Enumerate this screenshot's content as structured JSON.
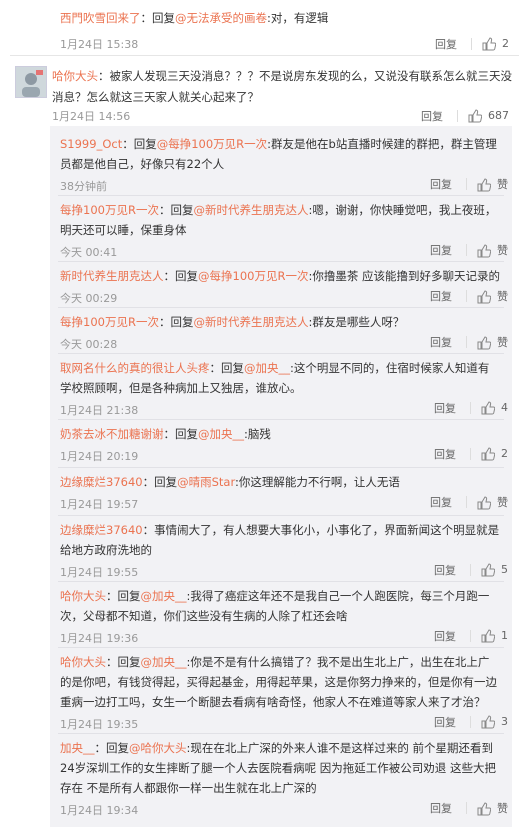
{
  "top_comment": {
    "user": "西門吹雪回来了",
    "reply_word": "：回复",
    "target": "@无法承受的画卷",
    "content": ":对，有逻辑",
    "time": "1月24日 15:38",
    "reply_label": "回复",
    "likes": "2"
  },
  "main_comment": {
    "user": "哈你大头",
    "content": "：被家人发现三天没消息？？？不是说房东发现的么，又说没有联系怎么就三天没消息？怎么就这三天家人就关心起来了？",
    "time": "1月24日 14:56",
    "reply_label": "回复",
    "likes": "687"
  },
  "replies": [
    {
      "user": "S1999_Oct",
      "reply_word": "：回复",
      "target": "@每挣100万见R一次",
      "content": ":群友是他在b站直播时候建的群把，群主管理员都是他自己，好像只有22个人",
      "time": "38分钟前",
      "reply_label": "回复",
      "likes": "赞"
    },
    {
      "user": "每挣100万见R一次",
      "reply_word": "：回复",
      "target": "@新时代养生朋克达人",
      "content": ":嗯，谢谢，你快睡觉吧，我上夜班，明天还可以睡，保重身体",
      "time": "今天 00:41",
      "reply_label": "回复",
      "likes": "赞"
    },
    {
      "user": "新时代养生朋克达人",
      "reply_word": "：回复",
      "target": "@每挣100万见R一次",
      "content": ":你撸墨茶 应该能撸到好多聊天记录的",
      "time": "今天 00:29",
      "reply_label": "回复",
      "likes": "赞"
    },
    {
      "user": "每挣100万见R一次",
      "reply_word": "：回复",
      "target": "@新时代养生朋克达人",
      "content": ":群友是哪些人呀？",
      "time": "今天 00:28",
      "reply_label": "回复",
      "likes": "赞"
    },
    {
      "user": "取网名什么的真的很让人头疼",
      "reply_word": "：回复",
      "target": "@加央__",
      "content": ":这个明显不同的，住宿时候家人知道有学校照顾啊，但是各种病加上又独居，谁放心。",
      "time": "1月24日 21:38",
      "reply_label": "回复",
      "likes": "4"
    },
    {
      "user": "奶茶去冰不加糖谢谢",
      "reply_word": "：回复",
      "target": "@加央__",
      "content": ":脑残",
      "time": "1月24日 20:19",
      "reply_label": "回复",
      "likes": "2"
    },
    {
      "user": "边缘糜烂37640",
      "reply_word": "：回复",
      "target": "@晴雨Star",
      "content": ":你这理解能力不行啊，让人无语",
      "time": "1月24日 19:57",
      "reply_label": "回复",
      "likes": "赞"
    },
    {
      "user": "边缘糜烂37640",
      "reply_word": "",
      "target": "",
      "content": "：事情闹大了，有人想要大事化小，小事化了，界面新闻这个明显就是给地方政府洗地的",
      "time": "1月24日 19:55",
      "reply_label": "回复",
      "likes": "5"
    },
    {
      "user": "哈你大头",
      "reply_word": "：回复",
      "target": "@加央__",
      "content": ":我得了癌症这年还不是我自己一个人跑医院，每三个月跑一次，父母都不知道，你们这些没有生病的人除了杠还会啥",
      "time": "1月24日 19:36",
      "reply_label": "回复",
      "likes": "1"
    },
    {
      "user": "哈你大头",
      "reply_word": "：回复",
      "target": "@加央__",
      "content": ":你是不是有什么搞错了？我不是出生北上广，出生在北上广的是你吧，有钱贷得起，买得起基金，用得起苹果，这是你努力挣来的，但是你有一边重病一边打工吗，女生一个断腿去看病有啥奇怪，他家人不在难道等家人来了才治？",
      "time": "1月24日 19:35",
      "reply_label": "回复",
      "likes": "3"
    },
    {
      "user": "加央__",
      "reply_word": "：回复",
      "target": "@哈你大头",
      "content": ":现在在北上广深的外来人谁不是这样过来的 前个星期还看到24岁深圳工作的女生摔断了腿一个人去医院看病呢 因为拖延工作被公司劝退 这些大把存在 不是所有人都跟你一样一出生就在北上广深的",
      "time": "1月24日 19:34",
      "reply_label": "回复",
      "likes": "赞"
    }
  ]
}
